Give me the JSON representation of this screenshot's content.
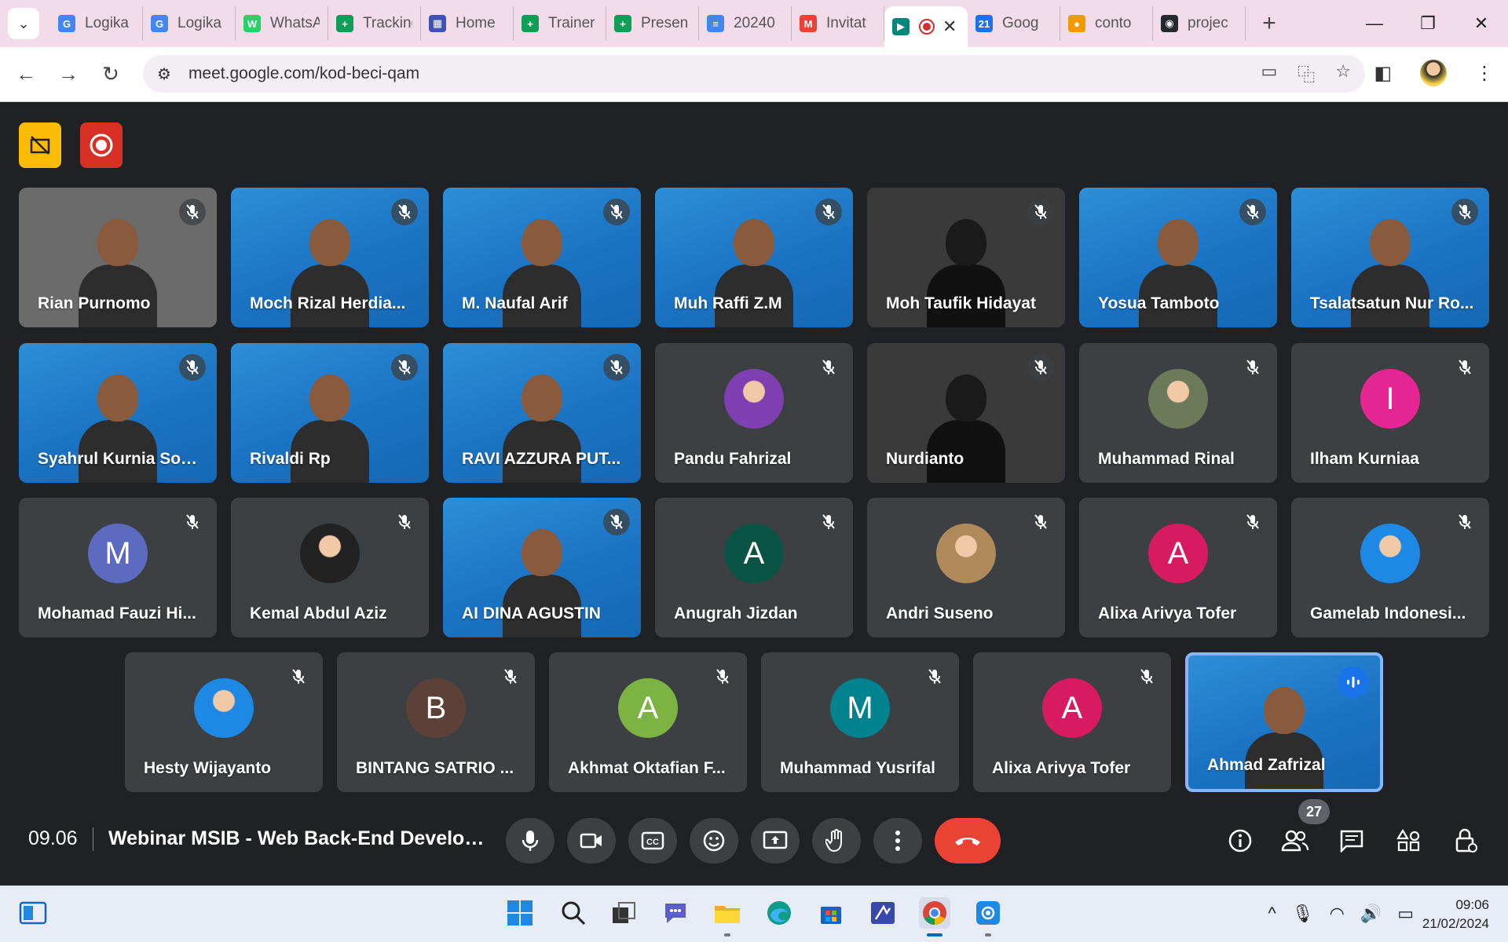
{
  "browser": {
    "tabs": [
      {
        "title": "Logika",
        "color": "#4285f4",
        "glyph": "G"
      },
      {
        "title": "Logika",
        "color": "#4285f4",
        "glyph": "G"
      },
      {
        "title": "WhatsApp",
        "color": "#25d366",
        "glyph": "W"
      },
      {
        "title": "Tracking",
        "color": "#0f9d58",
        "glyph": "+"
      },
      {
        "title": "Home",
        "color": "#3f51b5",
        "glyph": "▦"
      },
      {
        "title": "Trainer",
        "color": "#0f9d58",
        "glyph": "+"
      },
      {
        "title": "Presen",
        "color": "#0f9d58",
        "glyph": "+"
      },
      {
        "title": "20240",
        "color": "#4285f4",
        "glyph": "≡"
      },
      {
        "title": "Invitat",
        "color": "#ea4335",
        "glyph": "M"
      },
      {
        "title": "",
        "color": "#00897b",
        "glyph": "▶",
        "active": true
      },
      {
        "title": "Goog",
        "color": "#1a73e8",
        "glyph": "21"
      },
      {
        "title": "conto",
        "color": "#f29900",
        "glyph": "●"
      },
      {
        "title": "projec",
        "color": "#24292e",
        "glyph": "◉"
      }
    ],
    "url": "meet.google.com/kod-beci-qam"
  },
  "meeting": {
    "time": "09.06",
    "title": "Webinar MSIB - Web Back-End Develope...",
    "participant_count": "27"
  },
  "participants": [
    {
      "name": "Rian Purnomo",
      "kind": "video",
      "bg": "#6b6b6b"
    },
    {
      "name": "Moch Rizal Herdia...",
      "kind": "video-blue"
    },
    {
      "name": "M. Naufal Arif",
      "kind": "video-blue"
    },
    {
      "name": "Muh Raffi Z.M",
      "kind": "video-blue"
    },
    {
      "name": "Moh Taufik Hidayat",
      "kind": "video-dark"
    },
    {
      "name": "Yosua Tamboto",
      "kind": "video-blue"
    },
    {
      "name": "Tsalatsatun Nur Ro...",
      "kind": "video-blue"
    },
    {
      "name": "Syahrul Kurnia Sop...",
      "kind": "video-blue"
    },
    {
      "name": "Rivaldi Rp",
      "kind": "video-blue"
    },
    {
      "name": "RAVI AZZURA PUT...",
      "kind": "video-blue"
    },
    {
      "name": "Pandu Fahrizal",
      "kind": "photo",
      "color": "#7e3fb0"
    },
    {
      "name": "Nurdianto",
      "kind": "video-dark"
    },
    {
      "name": "Muhammad Rinal",
      "kind": "photo",
      "color": "#6d7a5a"
    },
    {
      "name": "Ilham Kurniaa",
      "kind": "letter",
      "letter": "I",
      "color": "#e52592"
    },
    {
      "name": "Mohamad Fauzi Hi...",
      "kind": "letter",
      "letter": "M",
      "color": "#5c6bc0"
    },
    {
      "name": "Kemal Abdul Aziz",
      "kind": "photo",
      "color": "#222222"
    },
    {
      "name": "AI DINA AGUSTIN",
      "kind": "video-blue"
    },
    {
      "name": "Anugrah Jizdan",
      "kind": "letter",
      "letter": "A",
      "color": "#0b5345"
    },
    {
      "name": "Andri Suseno",
      "kind": "photo",
      "color": "#b0895a"
    },
    {
      "name": "Alixa Arivya Tofer",
      "kind": "letter",
      "letter": "A",
      "color": "#d81b60"
    },
    {
      "name": "Gamelab Indonesi...",
      "kind": "photo",
      "color": "#1e88e5"
    },
    {
      "name": "Hesty Wijayanto",
      "kind": "photo",
      "color": "#1e88e5"
    },
    {
      "name": "BINTANG SATRIO ...",
      "kind": "letter",
      "letter": "B",
      "color": "#5d4037"
    },
    {
      "name": "Akhmat Oktafian F...",
      "kind": "letter",
      "letter": "A",
      "color": "#7cb342"
    },
    {
      "name": "Muhammad Yusrifal",
      "kind": "letter",
      "letter": "M",
      "color": "#00838f"
    },
    {
      "name": "Alixa Arivya Tofer",
      "kind": "letter",
      "letter": "A",
      "color": "#d81b60"
    },
    {
      "name": "Ahmad Zafrizal",
      "kind": "video-blue",
      "speaking": true
    }
  ],
  "taskbar": {
    "time": "09:06",
    "date": "21/02/2024"
  }
}
